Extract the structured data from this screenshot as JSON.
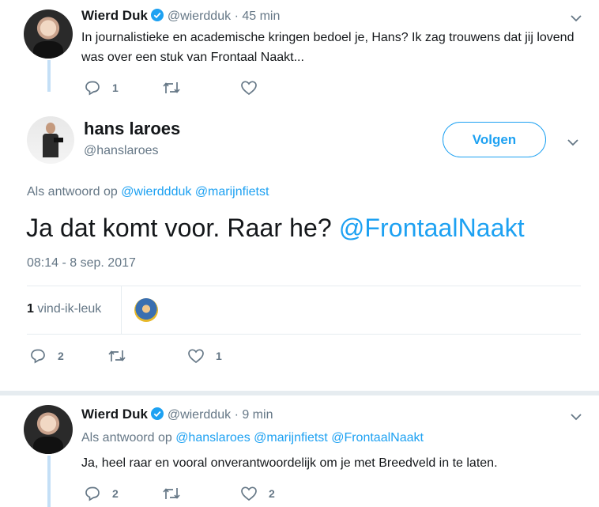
{
  "tweet1": {
    "name": "Wierd Duk",
    "handle": "@wierdduk",
    "time": "· 45 min",
    "text": "In journalistieke en academische kringen bedoel je, Hans? Ik zag trouwens dat jij lovend was over een stuk van Frontaal Naakt...",
    "reply_count": "1",
    "like_count": ""
  },
  "main": {
    "name": "hans laroes",
    "handle": "@hanslaroes",
    "follow_label": "Volgen",
    "reply_prefix": "Als antwoord op",
    "reply_to": [
      "@wierddduk",
      "@marijnfietst"
    ],
    "text": "Ja dat komt voor. Raar he?",
    "mention": "@FrontaalNaakt",
    "timestamp": "08:14 - 8 sep. 2017",
    "likes_count": "1",
    "likes_label": "vind-ik-leuk",
    "reply_count": "2",
    "like_count": "1"
  },
  "tweet3": {
    "name": "Wierd Duk",
    "handle": "@wierdduk",
    "time": "· 9 min",
    "reply_prefix": "Als antwoord op",
    "reply_to": [
      "@hanslaroes",
      "@marijnfietst",
      "@FrontaalNaakt"
    ],
    "text": "Ja, heel raar en vooral onverantwoordelijk om je met Breedveld in te laten.",
    "reply_count": "2",
    "like_count": "2"
  },
  "colors": {
    "accent": "#1da1f2",
    "muted": "#657786",
    "thread": "#c4dff6"
  },
  "icons": [
    "reply-icon",
    "retweet-icon",
    "heart-icon",
    "chevron-down-icon",
    "verified-icon"
  ]
}
